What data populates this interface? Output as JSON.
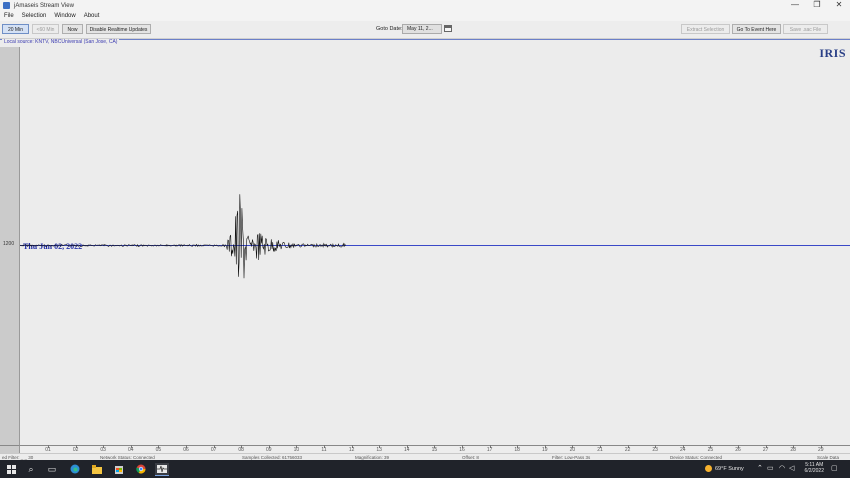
{
  "window": {
    "title": "jAmaseis Stream View",
    "controls": [
      "—",
      "❐",
      "✕"
    ]
  },
  "menu": [
    "File",
    "Selection",
    "Window",
    "About"
  ],
  "toolbar": {
    "btn_20min": "20 Min",
    "btn_prev": "<60 Min",
    "btn_now": "Now",
    "btn_disable": "Disable Realtime Updates",
    "goto_label": "Goto Date:",
    "goto_value": "May 11, 2...",
    "btn_extract": "Extract Selection",
    "btn_goto_event": "Go To Event Here",
    "btn_save": "Save .sac File"
  },
  "panel": {
    "source_label": "Local source: KNTV, NBCUniversal (San Jose, CA)",
    "logo": "IRIS",
    "trace_time": "1200",
    "trace_date": "Thu Jun 02, 2022"
  },
  "axis": {
    "ticks": [
      "01",
      "02",
      "03",
      "04",
      "05",
      "06",
      "07",
      "08",
      "09",
      "10",
      "11",
      "12",
      "13",
      "14",
      "15",
      "16",
      "17",
      "18",
      "19",
      "20",
      "21",
      "22",
      "23",
      "24",
      "25",
      "26",
      "27",
      "28",
      "29"
    ]
  },
  "status": {
    "left": "ed Filter: _ _ 30",
    "network": "Network Status: Connected",
    "samples": "Samples Collected: 61756033",
    "magnification": "Magnification: 39",
    "offset": "Offset: 8",
    "filter": "Filter: Low-Pass 3s",
    "device": "Device Status: Connected",
    "right": "Scale Data"
  },
  "taskbar": {
    "weather": "69°F  Sunny",
    "time": "5:11 AM",
    "date": "6/2/2022"
  },
  "colors": {
    "trace": "#3a49c7",
    "seismogram": "#111111",
    "taskbar": "#20232a"
  }
}
